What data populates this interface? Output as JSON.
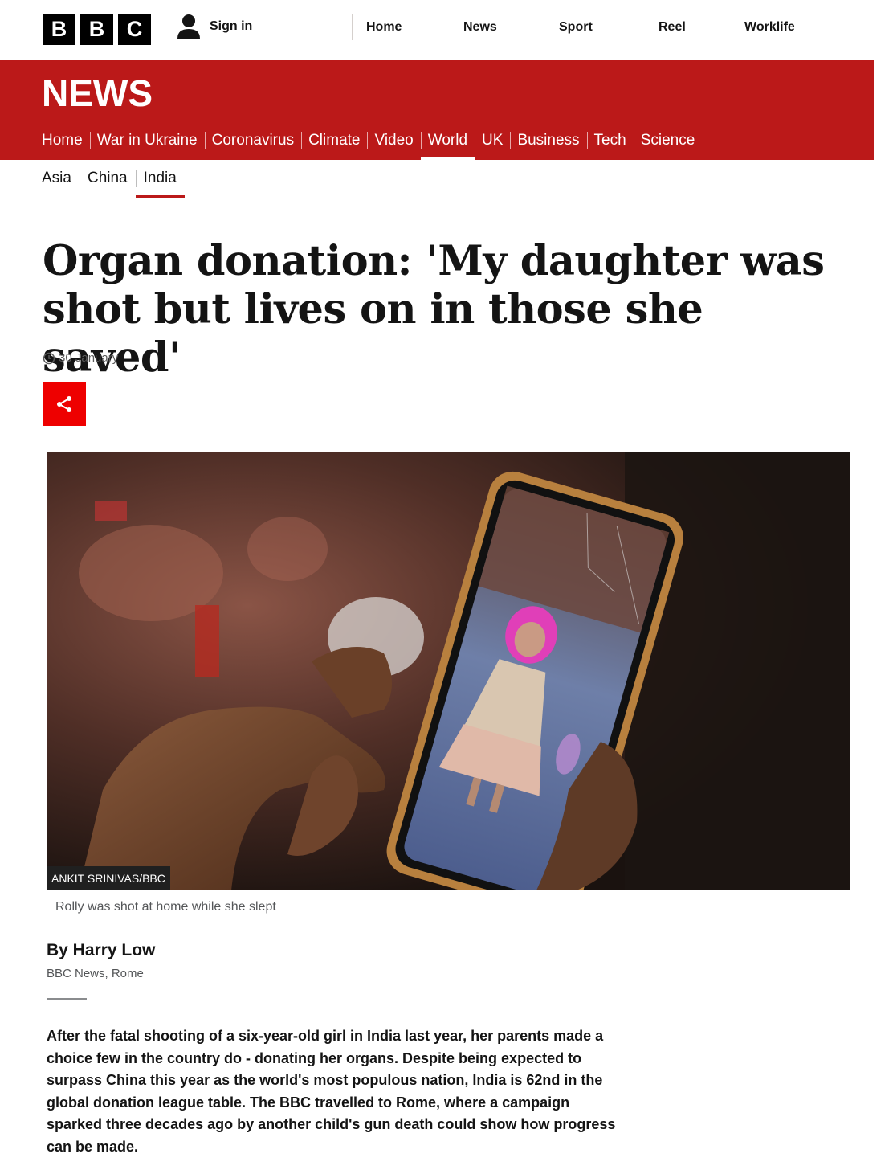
{
  "masthead": {
    "logo_letters": [
      "B",
      "B",
      "C"
    ],
    "signin_label": "Sign in",
    "nav": [
      "Home",
      "News",
      "Sport",
      "Reel",
      "Worklife"
    ]
  },
  "news_header": {
    "title": "NEWS",
    "nav": [
      "Home",
      "War in Ukraine",
      "Coronavirus",
      "Climate",
      "Video",
      "World",
      "UK",
      "Business",
      "Tech",
      "Science"
    ],
    "active": "World"
  },
  "subnav": {
    "items": [
      "Asia",
      "China",
      "India"
    ],
    "active": "India"
  },
  "article": {
    "headline_line1": "Organ donation: 'My daughter was",
    "headline_line2": "shot but lives on in those she saved'",
    "date": "30 January",
    "image_credit": "ANKIT SRINIVAS/BBC",
    "image_caption": "Rolly was shot at home while she slept",
    "byline_name": "By Harry Low",
    "byline_org": "BBC News, Rome",
    "intro": "After the fatal shooting of a six-year-old girl in India last year, her parents made a choice few in the country do - donating her organs. Despite being expected to surpass China this year as the world's most populous nation, India is 62nd in the global donation league table. The BBC travelled to Rome, where a campaign sparked three decades ago by another child's gun death could show how progress can be made."
  },
  "colors": {
    "brand_red": "#bb1919",
    "share_red": "#ee0000"
  },
  "icons": {
    "signin": "user-icon",
    "timestamp": "clock-icon",
    "share": "share-icon"
  }
}
